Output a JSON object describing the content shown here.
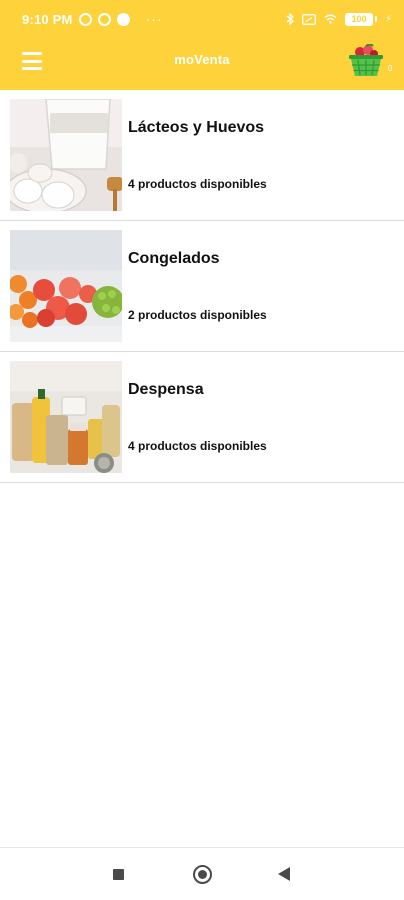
{
  "status_bar": {
    "time": "9:10 PM",
    "battery": "100",
    "icons": [
      "notification-icon",
      "vpn-icon",
      "check-circle-icon",
      "bluetooth-icon",
      "sim-icon",
      "wifi-icon",
      "battery-icon"
    ]
  },
  "app": {
    "title": "moVenta",
    "menu_icon": "hamburger-menu-icon",
    "cart_icon": "shopping-basket-icon",
    "cart_count": "0"
  },
  "categories": [
    {
      "name": "Lácteos y Huevos",
      "count_text": "4 productos disponibles",
      "image": "milk-and-eggs-image"
    },
    {
      "name": "Congelados",
      "count_text": "2 productos disponibles",
      "image": "frozen-vegetables-image"
    },
    {
      "name": "Despensa",
      "count_text": "4 productos disponibles",
      "image": "pantry-items-image"
    }
  ],
  "colors": {
    "appbar": "#FDD23B",
    "divider": "#DCDCDC",
    "nav_icon": "#4A4A4A"
  },
  "nav": {
    "icons": [
      "recent-apps-icon",
      "home-icon",
      "back-icon"
    ]
  }
}
